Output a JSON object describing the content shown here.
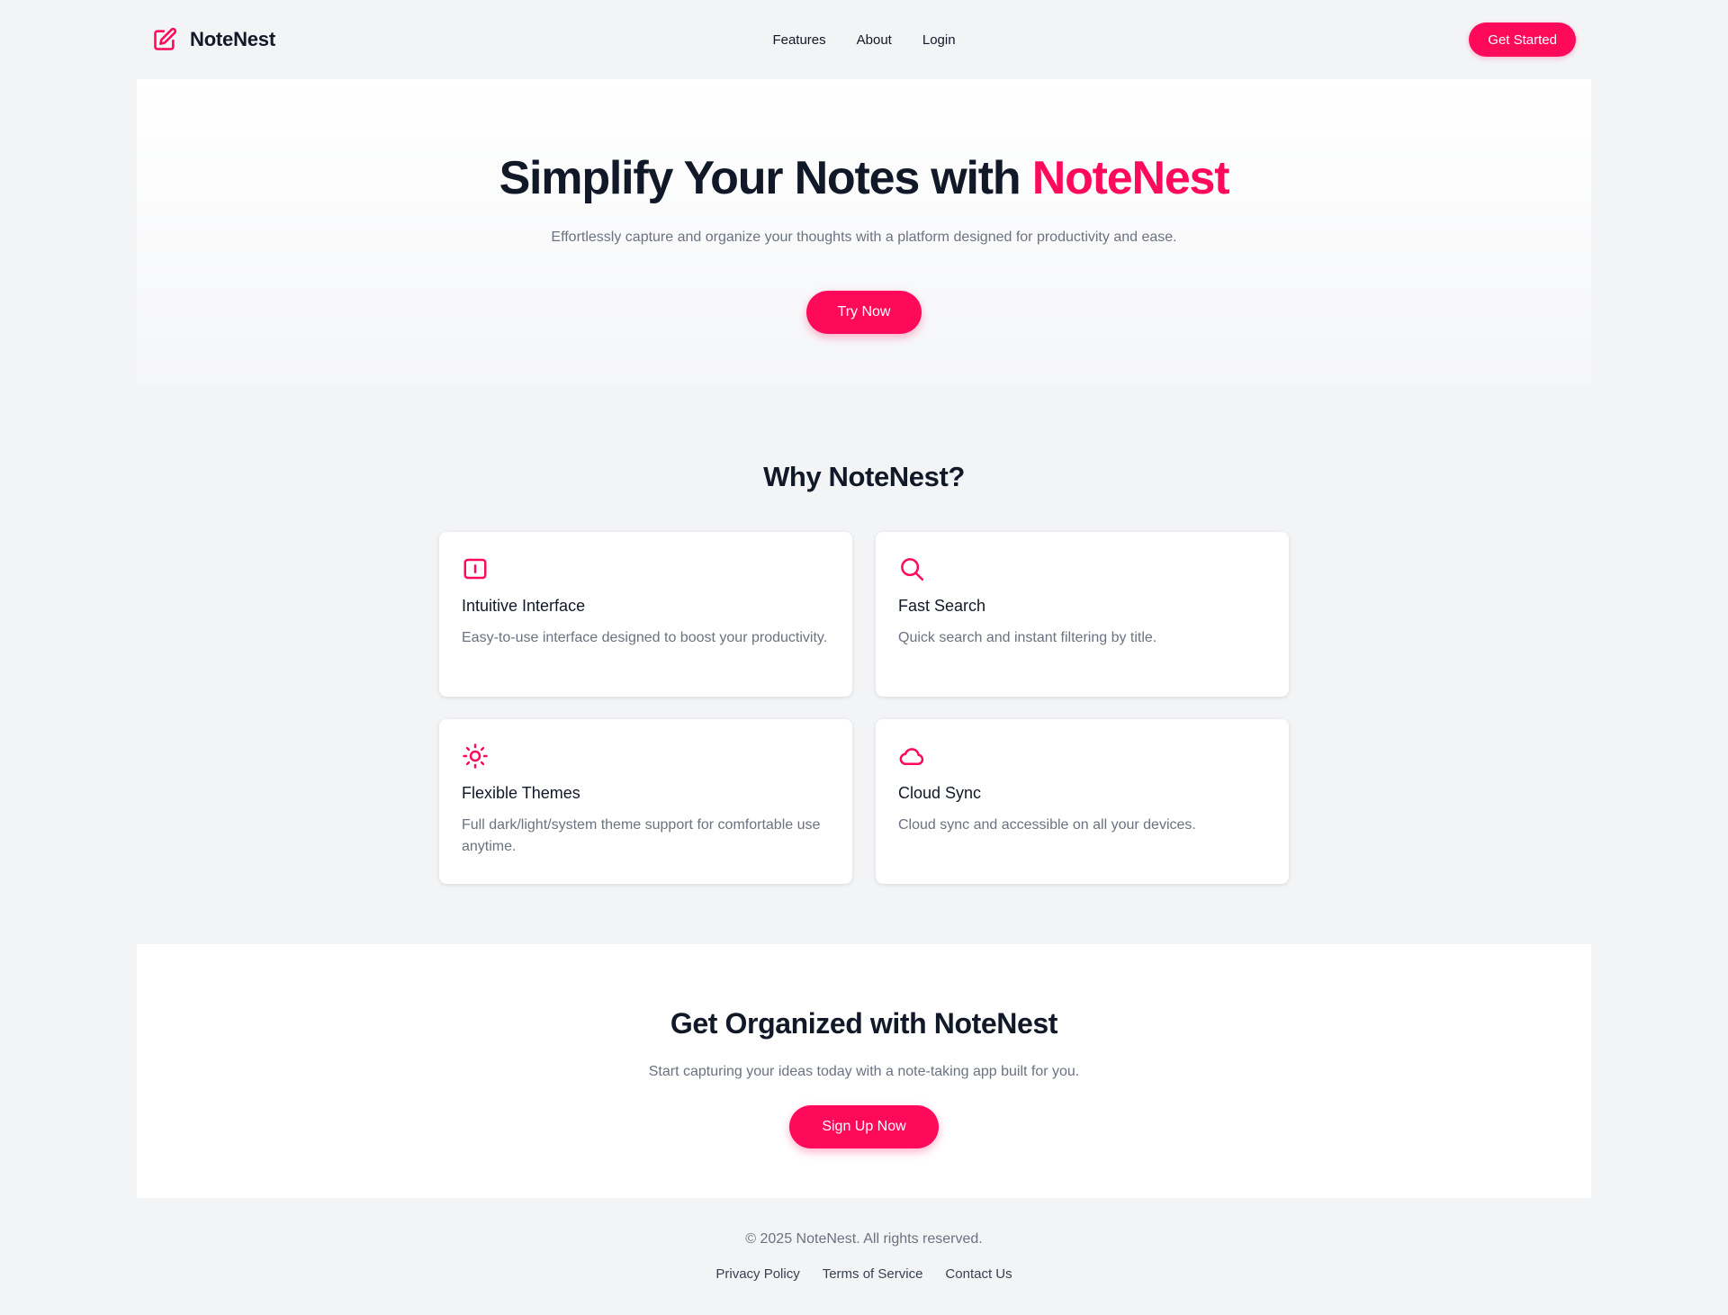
{
  "brand": {
    "name": "NoteNest",
    "icon": "pencil-square-icon"
  },
  "nav": {
    "items": [
      "Features",
      "About",
      "Login"
    ]
  },
  "header": {
    "cta_label": "Get Started"
  },
  "hero": {
    "title_prefix": "Simplify Your Notes with ",
    "title_accent": "NoteNest",
    "subtitle": "Effortlessly capture and organize your thoughts with a platform designed for productivity and ease.",
    "button_label": "Try Now"
  },
  "features": {
    "title": "Why NoteNest?",
    "cards": [
      {
        "icon": "interface-icon",
        "title": "Intuitive Interface",
        "description": "Easy-to-use interface designed to boost your productivity."
      },
      {
        "icon": "search-icon",
        "title": "Fast Search",
        "description": "Quick search and instant filtering by title."
      },
      {
        "icon": "sun-icon",
        "title": "Flexible Themes",
        "description": "Full dark/light/system theme support for comfortable use anytime."
      },
      {
        "icon": "cloud-icon",
        "title": "Cloud Sync",
        "description": "Cloud sync and accessible on all your devices."
      }
    ]
  },
  "cta": {
    "title": "Get Organized with NoteNest",
    "subtitle": "Start capturing your ideas today with a note-taking app built for you.",
    "button_label": "Sign Up Now"
  },
  "footer": {
    "copyright": "© 2025 NoteNest. All rights reserved.",
    "links": [
      "Privacy Policy",
      "Terms of Service",
      "Contact Us"
    ]
  },
  "colors": {
    "accent": "#ff0a5a",
    "background": "#f3f4f6",
    "text": "#111827",
    "muted": "#6b7280"
  }
}
